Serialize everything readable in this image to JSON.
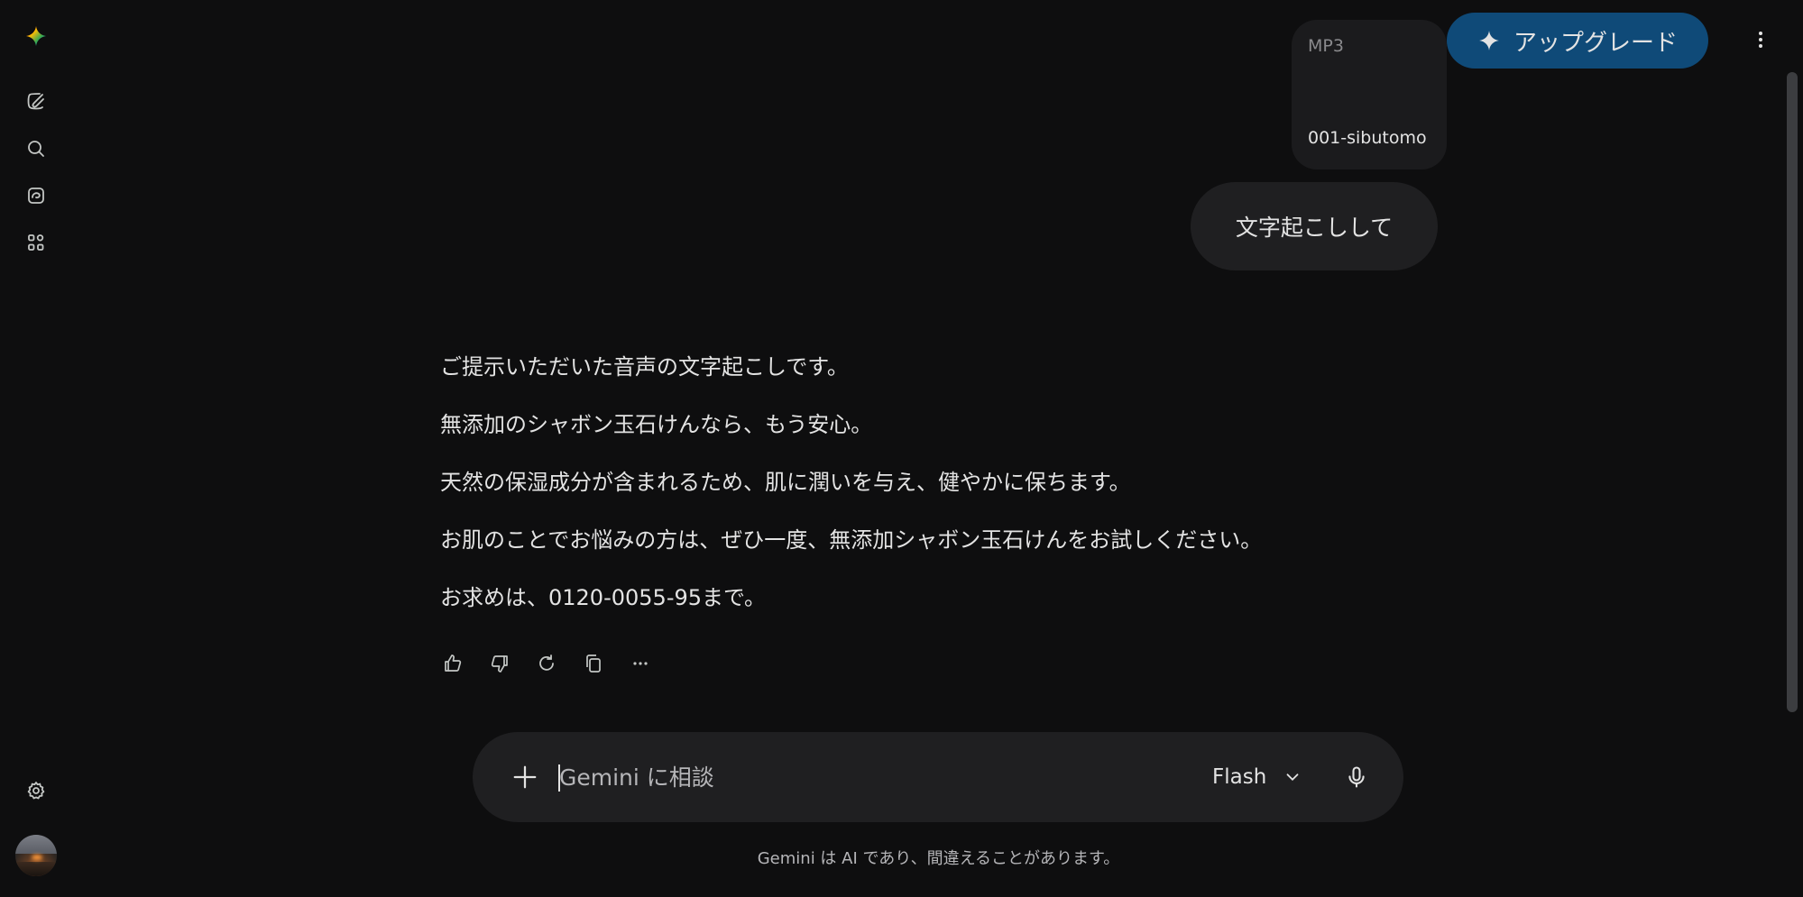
{
  "composer": {
    "placeholder": "Gemini に相談",
    "model_label": "Flash"
  },
  "header": {
    "upgrade_label": "アップグレード"
  },
  "attachment": {
    "type_label": "MP3",
    "file_name": "001-sibutomo"
  },
  "conversation": {
    "user_message": "文字起こしして",
    "response_paragraphs": [
      "ご提示いただいた音声の文字起こしです。",
      "無添加のシャボン玉石けんなら、もう安心。",
      "天然の保湿成分が含まれるため、肌に潤いを与え、健やかに保ちます。",
      "お肌のことでお悩みの方は、ぜひ一度、無添加シャボン玉石けんをお試しください。",
      "お求めは、0120-0055-95まで。"
    ]
  },
  "footer": {
    "disclaimer": "Gemini は AI であり、間違えることがあります。"
  },
  "colors": {
    "background": "#0e0e0f",
    "surface": "#1f1f21",
    "accent": "#0f4a78",
    "text": "#e3e3e3"
  },
  "icons": {
    "rail": [
      "gemini-logo-icon",
      "new-chat-icon",
      "search-icon",
      "gems-icon",
      "apps-icon",
      "settings-icon"
    ],
    "actions": [
      "thumb-up-icon",
      "thumb-down-icon",
      "refresh-icon",
      "copy-icon",
      "more-horiz-icon"
    ]
  }
}
